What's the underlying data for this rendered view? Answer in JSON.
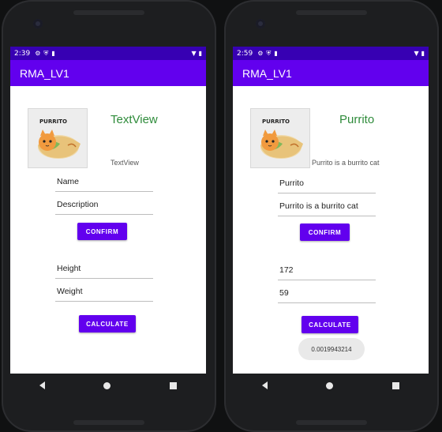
{
  "left": {
    "status_time": "2:39",
    "app_title": "RMA_LV1",
    "title_text": "TextView",
    "sub_text": "TextView",
    "name_field": "Name",
    "description_field": "Description",
    "confirm_label": "CONFIRM",
    "height_field": "Height",
    "weight_field": "Weight",
    "calculate_label": "CALCULATE"
  },
  "right": {
    "status_time": "2:59",
    "app_title": "RMA_LV1",
    "title_text": "Purrito",
    "sub_text": "Purrito is a burrito cat",
    "name_field": "Purrito",
    "description_field": "Purrito is a burrito cat",
    "confirm_label": "CONFIRM",
    "height_field": "172",
    "weight_field": "59",
    "calculate_label": "CALCULATE",
    "result": "0.0019943214"
  },
  "image_label": "PURRITO",
  "colors": {
    "status_bar": "#3700b3",
    "app_bar": "#6200ee",
    "title_green": "#2e8b3a"
  },
  "icons": {
    "status_left": [
      "gear-icon",
      "shield-icon",
      "sim-icon"
    ],
    "status_right": [
      "wifi-icon",
      "battery-icon"
    ],
    "nav": [
      "back-icon",
      "home-icon",
      "recents-icon"
    ]
  }
}
